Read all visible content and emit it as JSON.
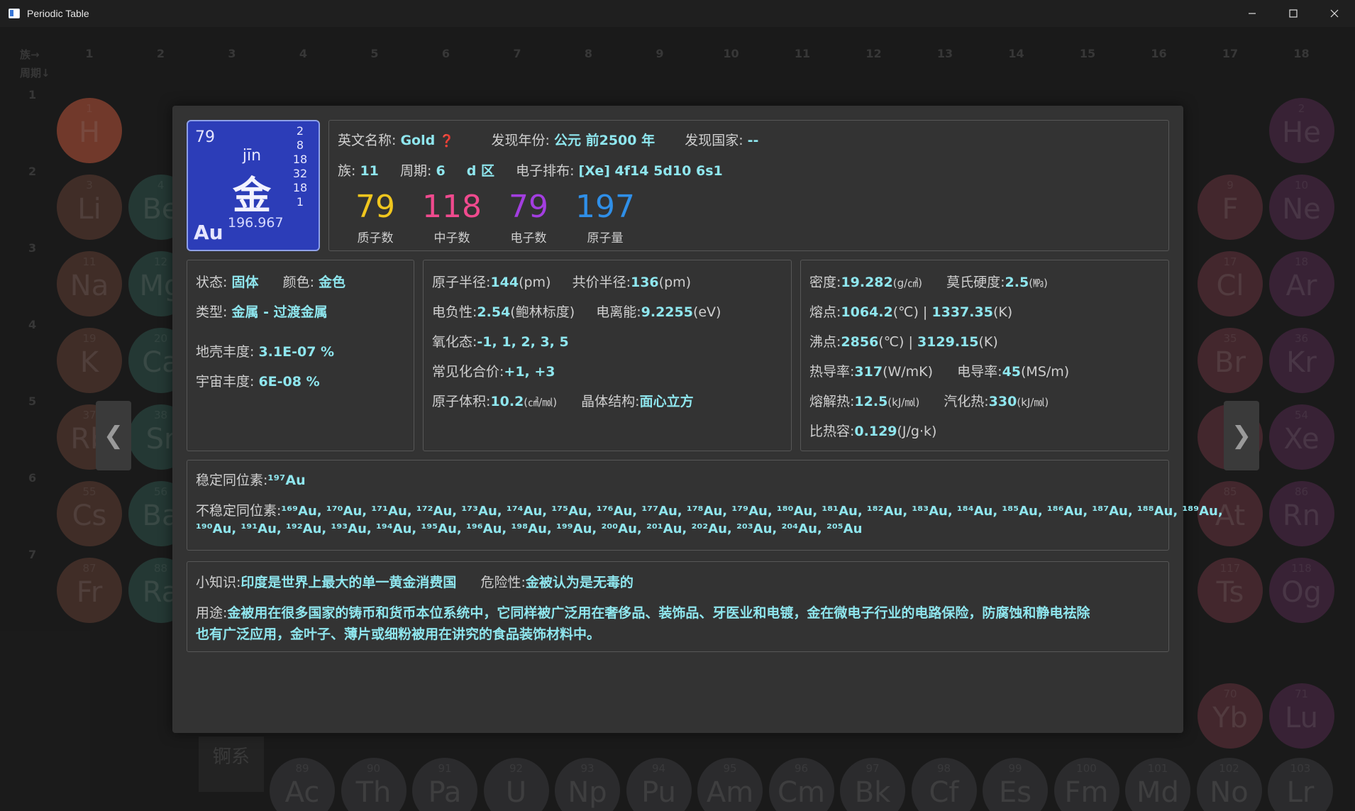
{
  "window": {
    "title": "Periodic Table"
  },
  "background": {
    "group_axis_label": "族→",
    "period_axis_label": "周期↓",
    "groups": [
      "1",
      "2",
      "3",
      "4",
      "5",
      "6",
      "7",
      "8",
      "9",
      "10",
      "11",
      "12",
      "13",
      "14",
      "15",
      "16",
      "17",
      "18"
    ],
    "periods": [
      "1",
      "2",
      "3",
      "4",
      "5",
      "6",
      "7"
    ],
    "actinide_label": "锕系",
    "elements": [
      {
        "n": "1",
        "s": "H"
      },
      {
        "n": "3",
        "s": "Li"
      },
      {
        "n": "4",
        "s": "Be"
      },
      {
        "n": "11",
        "s": "Na"
      },
      {
        "n": "12",
        "s": "Mg"
      },
      {
        "n": "19",
        "s": "K"
      },
      {
        "n": "20",
        "s": "Ca"
      },
      {
        "n": "37",
        "s": "Rb"
      },
      {
        "n": "38",
        "s": "Sr"
      },
      {
        "n": "55",
        "s": "Cs"
      },
      {
        "n": "56",
        "s": "Ba"
      },
      {
        "n": "87",
        "s": "Fr"
      },
      {
        "n": "88",
        "s": "Ra"
      },
      {
        "n": "2",
        "s": "He"
      },
      {
        "n": "9",
        "s": "F"
      },
      {
        "n": "10",
        "s": "Ne"
      },
      {
        "n": "17",
        "s": "Cl"
      },
      {
        "n": "18",
        "s": "Ar"
      },
      {
        "n": "35",
        "s": "Br"
      },
      {
        "n": "36",
        "s": "Kr"
      },
      {
        "n": "53",
        "s": "I"
      },
      {
        "n": "54",
        "s": "Xe"
      },
      {
        "n": "85",
        "s": "At"
      },
      {
        "n": "86",
        "s": "Rn"
      },
      {
        "n": "117",
        "s": "Ts"
      },
      {
        "n": "118",
        "s": "Og"
      },
      {
        "n": "70",
        "s": "Yb"
      },
      {
        "n": "71",
        "s": "Lu"
      },
      {
        "n": "89",
        "s": "Ac"
      },
      {
        "n": "90",
        "s": "Th"
      },
      {
        "n": "91",
        "s": "Pa"
      },
      {
        "n": "92",
        "s": "U"
      },
      {
        "n": "93",
        "s": "Np"
      },
      {
        "n": "94",
        "s": "Pu"
      },
      {
        "n": "95",
        "s": "Am"
      },
      {
        "n": "96",
        "s": "Cm"
      },
      {
        "n": "97",
        "s": "Bk"
      },
      {
        "n": "98",
        "s": "Cf"
      },
      {
        "n": "99",
        "s": "Es"
      },
      {
        "n": "100",
        "s": "Fm"
      },
      {
        "n": "101",
        "s": "Md"
      },
      {
        "n": "102",
        "s": "No"
      },
      {
        "n": "103",
        "s": "Lr"
      }
    ]
  },
  "nav": {
    "prev": "❮",
    "next": "❯"
  },
  "element": {
    "atomic_number": "79",
    "pinyin": "jīn",
    "chinese": "金",
    "symbol": "Au",
    "mass": "196.967",
    "shells": [
      "2",
      "8",
      "18",
      "32",
      "18",
      "1"
    ],
    "english_name_label": "英文名称:",
    "english_name": "Gold",
    "help_icon": "❓",
    "discovery_year_label": "发现年份:",
    "discovery_year": "公元 前2500 年",
    "discovery_country_label": "发现国家:",
    "discovery_country": "--",
    "group_label": "族:",
    "group": "11",
    "period_label": "周期:",
    "period": "6",
    "block": "d 区",
    "config_label": "电子排布:",
    "config": "[Xe] 4f14 5d10 6s1",
    "counts": [
      {
        "value": "79",
        "label": "质子数",
        "color": "#f0c61e"
      },
      {
        "value": "118",
        "label": "中子数",
        "color": "#f04a8e"
      },
      {
        "value": "79",
        "label": "电子数",
        "color": "#a33ee0"
      },
      {
        "value": "197",
        "label": "原子量",
        "color": "#2f8fe8"
      }
    ]
  },
  "physical": {
    "state_label": "状态:",
    "state": "固体",
    "color_label": "颜色:",
    "color": "金色",
    "type_label": "类型:",
    "type": "金属 - 过渡金属",
    "crust_label": "地壳丰度:",
    "crust": "3.1E-07 %",
    "universe_label": "宇宙丰度:",
    "universe": "6E-08 %"
  },
  "atomic": {
    "radius_label": "原子半径:",
    "radius": "144",
    "radius_unit": "(pm)",
    "cov_label": "共价半径:",
    "cov": "136",
    "cov_unit": "(pm)",
    "en_label": "电负性:",
    "en": "2.54",
    "en_unit": "(鲍林标度)",
    "ie_label": "电离能:",
    "ie": "9.2255",
    "ie_unit": "(eV)",
    "ox_label": "氧化态:",
    "ox": "-1, 1, 2, 3, 5",
    "val_label": "常见化合价:",
    "valence": "+1, +3",
    "vol_label": "原子体积:",
    "vol": "10.2",
    "vol_unit": "(㎤/㏖)",
    "crystal_label": "晶体结构:",
    "crystal": "面心立方"
  },
  "thermal": {
    "density_label": "密度:",
    "density": "19.282",
    "density_unit": "(g/㎤)",
    "hard_label": "莫氏硬度:",
    "hard": "2.5",
    "hard_unit": "(㎫)",
    "melt_label": "熔点:",
    "melt_c": "1064.2",
    "melt_c_unit": "(℃) | ",
    "melt_k": "1337.35",
    "melt_k_unit": "(K)",
    "boil_label": "沸点:",
    "boil_c": "2856",
    "boil_c_unit": "(℃) | ",
    "boil_k": "3129.15",
    "boil_k_unit": "(K)",
    "tc_label": "热导率:",
    "tc": "317",
    "tc_unit": "(W/mK)",
    "ec_label": "电导率:",
    "ec": "45",
    "ec_unit": "(MS/m)",
    "fus_label": "熔解热:",
    "fus": "12.5",
    "fus_unit": "(kJ/㏖)",
    "vap_label": "汽化热:",
    "vap": "330",
    "vap_unit": "(kJ/㏖)",
    "sh_label": "比热容:",
    "sh": "0.129",
    "sh_unit": "(J/g·k)"
  },
  "isotopes": {
    "stable_label": "稳定同位素:",
    "stable": "¹⁹⁷Au",
    "unstable_label": "不稳定同位素:",
    "unstable_line1": "¹⁶⁹Au, ¹⁷⁰Au, ¹⁷¹Au, ¹⁷²Au, ¹⁷³Au, ¹⁷⁴Au, ¹⁷⁵Au, ¹⁷⁶Au, ¹⁷⁷Au, ¹⁷⁸Au, ¹⁷⁹Au, ¹⁸⁰Au, ¹⁸¹Au, ¹⁸²Au, ¹⁸³Au, ¹⁸⁴Au, ¹⁸⁵Au, ¹⁸⁶Au, ¹⁸⁷Au, ¹⁸⁸Au, ¹⁸⁹Au,",
    "unstable_line2": "¹⁹⁰Au, ¹⁹¹Au, ¹⁹²Au, ¹⁹³Au, ¹⁹⁴Au, ¹⁹⁵Au, ¹⁹⁶Au, ¹⁹⁸Au, ¹⁹⁹Au, ²⁰⁰Au, ²⁰¹Au, ²⁰²Au, ²⁰³Au, ²⁰⁴Au, ²⁰⁵Au"
  },
  "trivia": {
    "fact_label": "小知识:",
    "fact": "印度是世界上最大的单一黄金消费国",
    "hazard_label": "危险性:",
    "hazard": "金被认为是无毒的",
    "use_label": "用途:",
    "use_line1": "金被用在很多国家的铸币和货币本位系统中，它同样被广泛用在奢侈品、装饰品、牙医业和电镀，金在微电子行业的电路保险，防腐蚀和静电祛除",
    "use_line2": "也有广泛应用，金叶子、薄片或细粉被用在讲究的食品装饰材料中。"
  }
}
